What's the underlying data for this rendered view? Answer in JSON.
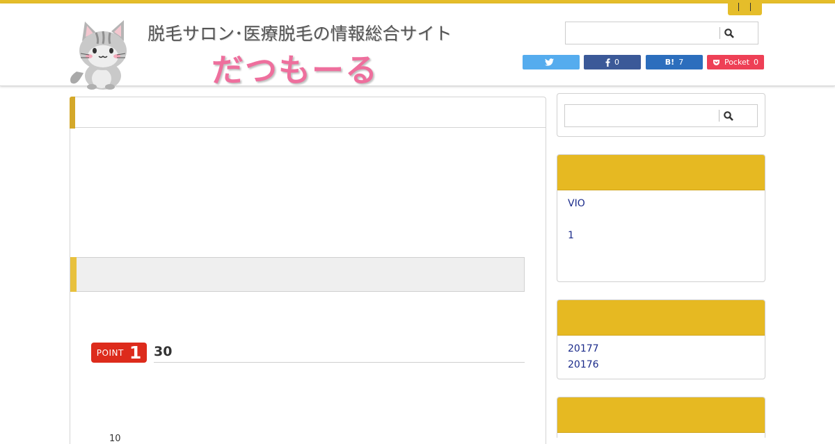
{
  "header": {
    "tagline": "脱毛サロン･医療脱毛の情報総合サイト",
    "brand": "だつもーる",
    "search_placeholder": ""
  },
  "share": {
    "twitter": {
      "icon": "twitter-bird-icon",
      "count": ""
    },
    "facebook": {
      "icon": "facebook-f-icon",
      "count": "0"
    },
    "hatena": {
      "icon": "hatena-bookmark-icon",
      "label": "B!",
      "count": "7"
    },
    "pocket": {
      "icon": "pocket-icon",
      "label": "Pocket",
      "count": "0"
    }
  },
  "main": {
    "point_label": "POINT",
    "point_number": "1",
    "point_title": "30",
    "cut_text": "10"
  },
  "sidebar": {
    "search_placeholder": "",
    "widget1_links": [
      "VIO",
      "1"
    ],
    "widget2_links": [
      "20177",
      "20176"
    ]
  },
  "colors": {
    "accent": "#e5bd2a",
    "brand_pink": "#ee6f9d",
    "point_red": "#dd2b1c",
    "twitter": "#55acee",
    "facebook": "#3b5998",
    "hatena": "#2c6ebd",
    "pocket": "#ee4056",
    "link": "#1a2a8a"
  }
}
